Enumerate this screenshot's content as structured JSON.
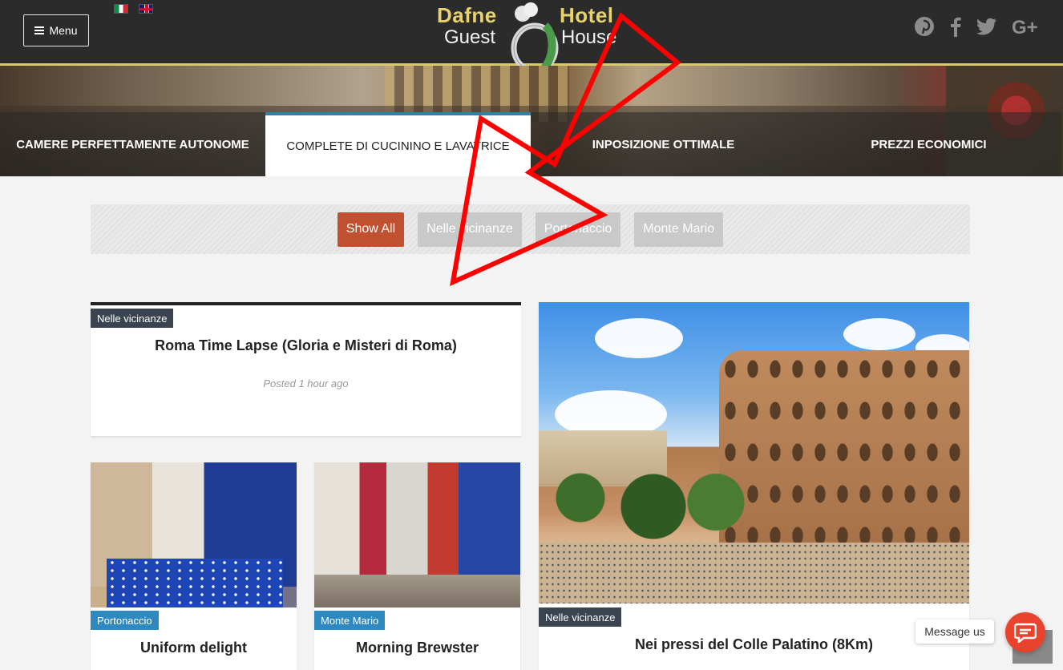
{
  "header": {
    "menu_label": "Menu",
    "logo": {
      "line1_left": "Dafne",
      "line1_right": "Hotel",
      "line2_left": "Guest",
      "line2_right": "House"
    },
    "socials": [
      "pinterest-icon",
      "facebook-icon",
      "twitter-icon",
      "google-plus-icon"
    ],
    "social_glyphs": {
      "pinterest": "℗",
      "facebook": "f",
      "twitter": "🐦",
      "gplus": "G+"
    }
  },
  "tabs": [
    {
      "label": "CAMERE PERFETTAMENTE AUTONOME",
      "active": false
    },
    {
      "label": "COMPLETE DI CUCININO E LAVATRICE",
      "active": true
    },
    {
      "label": "INPOSIZIONE OTTIMALE",
      "active": false
    },
    {
      "label": "PREZZI ECONOMICI",
      "active": false
    }
  ],
  "filters": [
    {
      "label": "Show All",
      "active": true
    },
    {
      "label": "Nelle vicinanze",
      "active": false
    },
    {
      "label": "Portonaccio",
      "active": false
    },
    {
      "label": "Monte Mario",
      "active": false
    }
  ],
  "posts": [
    {
      "category": "Nelle vicinanze",
      "title": "Roma Time Lapse (Gloria e Misteri di Roma)",
      "posted": "Posted 1 hour ago"
    },
    {
      "category": "Portonaccio",
      "title": "Uniform delight"
    },
    {
      "category": "Monte Mario",
      "title": "Morning Brewster"
    },
    {
      "category": "Nelle vicinanze",
      "title": "Nei pressi del Colle Palatino (8Km)"
    }
  ],
  "chat": {
    "tooltip": "Message us"
  },
  "colors": {
    "accent_red": "#c0502f",
    "header_bg": "#2b2b2b",
    "logo_gold": "#e7d36b",
    "tab_active_border": "#2c83a8",
    "annotation_arrow": "#ff0000"
  }
}
